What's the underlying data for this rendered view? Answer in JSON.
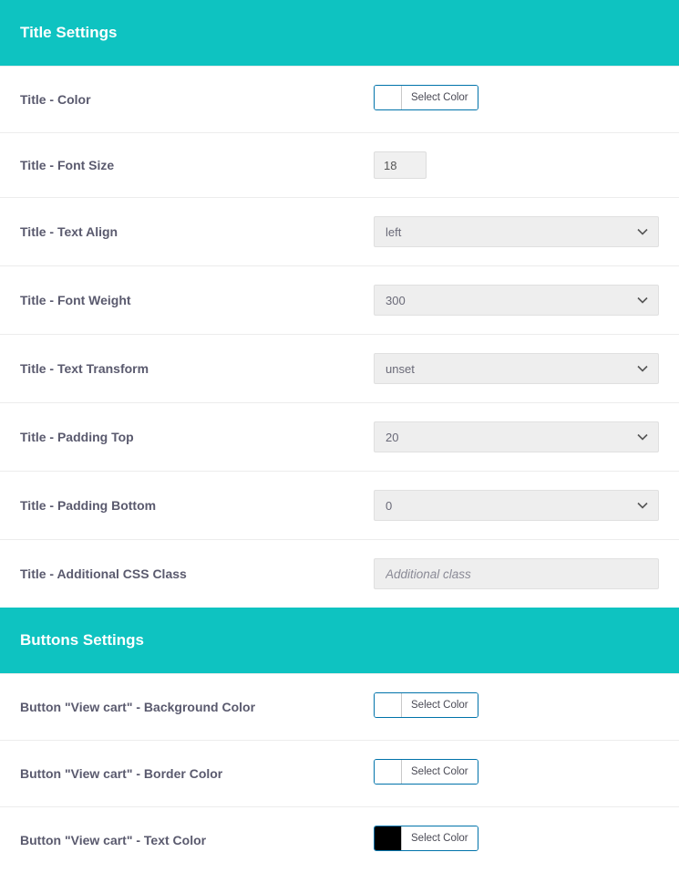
{
  "sections": {
    "title": {
      "header": "Title Settings",
      "rows": {
        "color": {
          "label": "Title - Color",
          "picker_label": "Select Color",
          "swatch": "#ffffff"
        },
        "fontSize": {
          "label": "Title - Font Size",
          "value": "18"
        },
        "textAlign": {
          "label": "Title - Text Align",
          "value": "left"
        },
        "fontWeight": {
          "label": "Title - Font Weight",
          "value": "300"
        },
        "transform": {
          "label": "Title - Text Transform",
          "value": "unset"
        },
        "padTop": {
          "label": "Title - Padding Top",
          "value": "20"
        },
        "padBottom": {
          "label": "Title - Padding Bottom",
          "value": "0"
        },
        "cssClass": {
          "label": "Title - Additional CSS Class",
          "placeholder": "Additional class"
        }
      }
    },
    "buttons": {
      "header": "Buttons Settings",
      "rows": {
        "vcBg": {
          "label": "Button \"View cart\" - Background Color",
          "picker_label": "Select Color",
          "swatch": "#ffffff"
        },
        "vcBorder": {
          "label": "Button \"View cart\" - Border Color",
          "picker_label": "Select Color",
          "swatch": "#ffffff"
        },
        "vcText": {
          "label": "Button \"View cart\" - Text Color",
          "picker_label": "Select Color",
          "swatch": "#000000"
        }
      }
    }
  }
}
